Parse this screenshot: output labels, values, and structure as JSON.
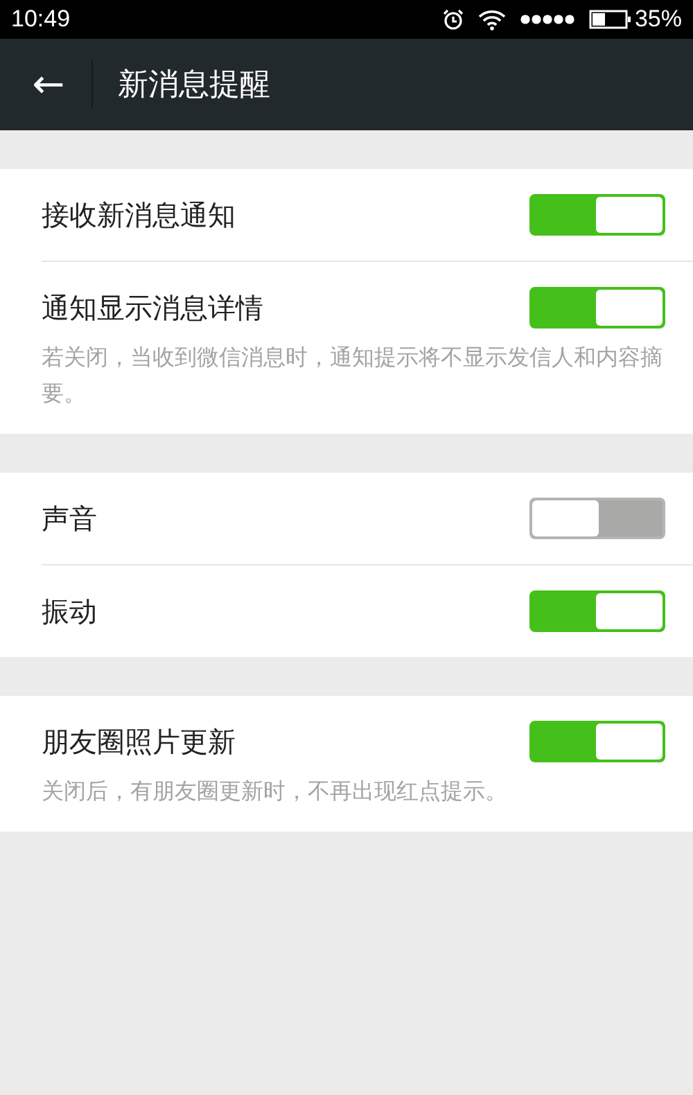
{
  "status_bar": {
    "time": "10:49",
    "battery": "35%"
  },
  "toolbar": {
    "back": "←",
    "title": "新消息提醒"
  },
  "groups": [
    {
      "items": [
        {
          "label": "接收新消息通知",
          "on": true
        },
        {
          "label": "通知显示消息详情",
          "on": true,
          "hint": "若关闭，当收到微信消息时，通知提示将不显示发信人和内容摘要。"
        }
      ]
    },
    {
      "items": [
        {
          "label": "声音",
          "on": false
        },
        {
          "label": "振动",
          "on": true
        }
      ]
    },
    {
      "items": [
        {
          "label": "朋友圈照片更新",
          "on": true,
          "hint": "关闭后，有朋友圈更新时，不再出现红点提示。"
        }
      ]
    }
  ]
}
